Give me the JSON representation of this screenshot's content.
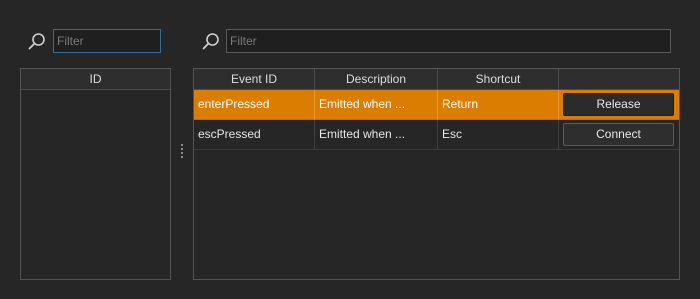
{
  "left_search": {
    "placeholder": "Filter",
    "value": ""
  },
  "right_search": {
    "placeholder": "Filter",
    "value": ""
  },
  "icons": {
    "search": "search-icon",
    "splitter": "splitter-handle-icon"
  },
  "colors": {
    "selection": "#db7d00",
    "focus_border": "#2f6f9f",
    "background": "#262626"
  },
  "left_table": {
    "columns": [
      "ID"
    ]
  },
  "events_table": {
    "columns": [
      "Event ID",
      "Description",
      "Shortcut",
      ""
    ],
    "rows": [
      {
        "event_id": "enterPressed",
        "description": "Emitted when ...",
        "shortcut": "Return",
        "action": "Release",
        "selected": true
      },
      {
        "event_id": "escPressed",
        "description": "Emitted when ...",
        "shortcut": "Esc",
        "action": "Connect",
        "selected": false
      }
    ]
  }
}
